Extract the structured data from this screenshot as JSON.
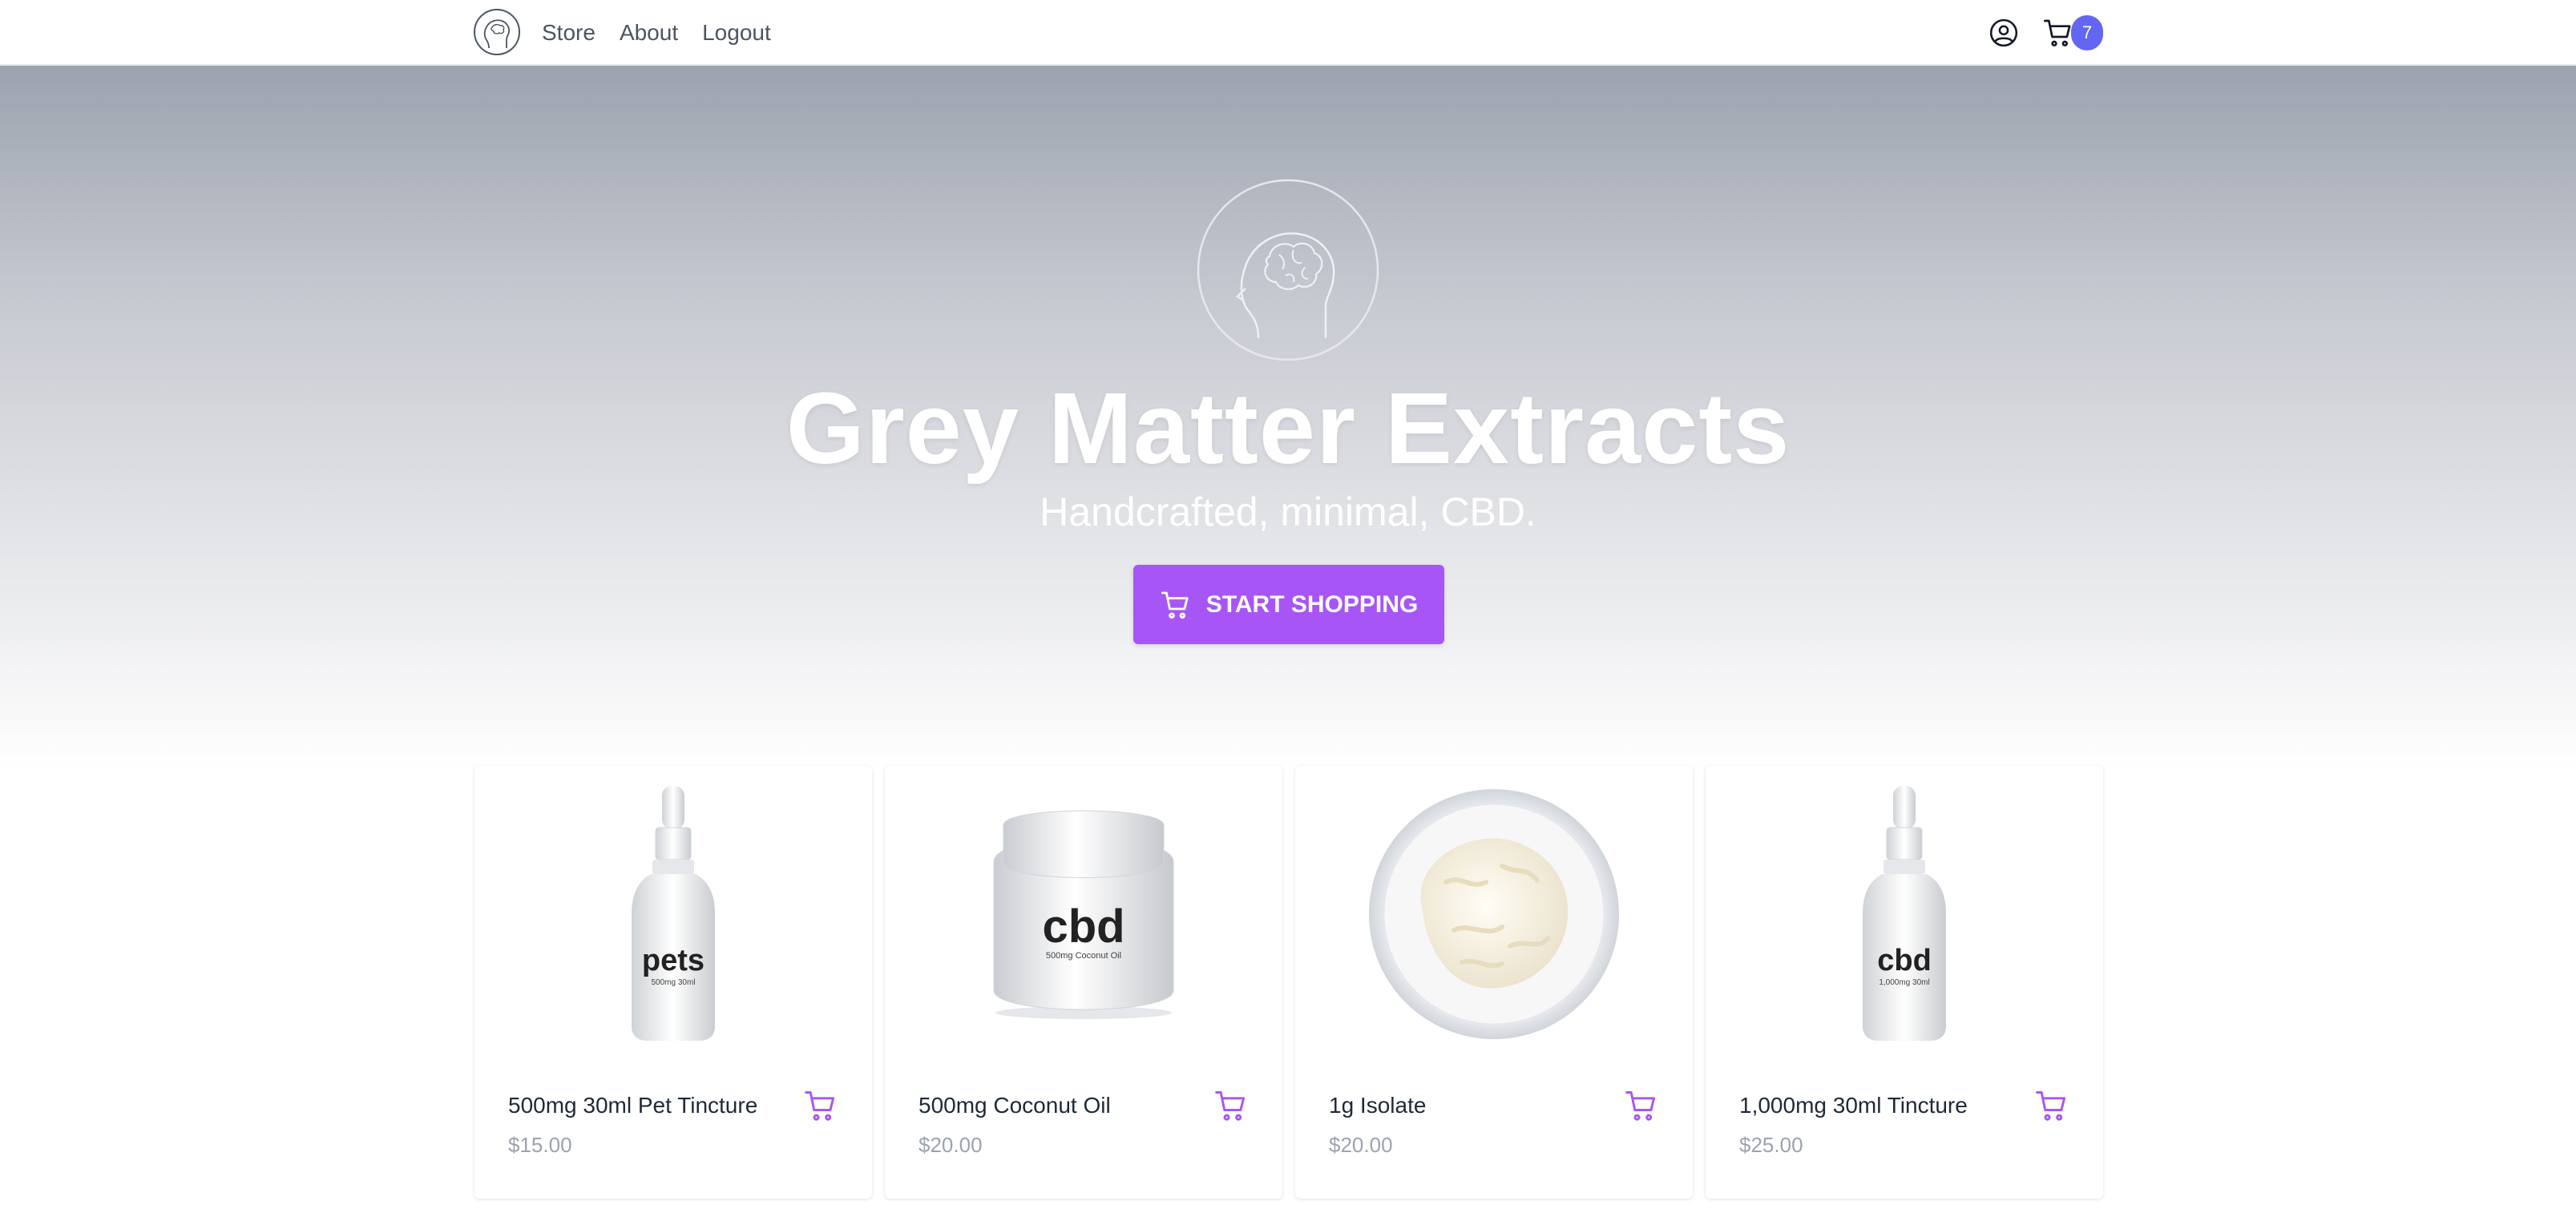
{
  "nav": {
    "logo_icon": "brain-head-icon",
    "links": [
      "Store",
      "About",
      "Logout"
    ],
    "account_icon": "user-circle-icon",
    "cart_icon": "cart-icon",
    "cart_count": "7",
    "badge_color": "#6366f1"
  },
  "hero": {
    "logo_icon": "brain-head-icon",
    "title": "Grey Matter Extracts",
    "subtitle": "Handcrafted, minimal, CBD.",
    "cta_label": "START SHOPPING",
    "cta_icon": "cart-icon",
    "cta_color": "#a855f7"
  },
  "products": [
    {
      "name": "500mg 30ml Pet Tincture",
      "price": "$15.00",
      "image_icon": "dropper-bottle-icon",
      "label": "pets",
      "sublabel": "500mg 30ml"
    },
    {
      "name": "500mg Coconut Oil",
      "price": "$20.00",
      "image_icon": "jar-icon",
      "label": "cbd",
      "sublabel": "500mg Coconut Oil"
    },
    {
      "name": "1g Isolate",
      "price": "$20.00",
      "image_icon": "isolate-dish-icon"
    },
    {
      "name": "1,000mg 30ml Tincture",
      "price": "$25.00",
      "image_icon": "dropper-bottle-icon",
      "label": "cbd",
      "sublabel": "1,000mg 30ml"
    }
  ],
  "accent_color": "#a855f7"
}
